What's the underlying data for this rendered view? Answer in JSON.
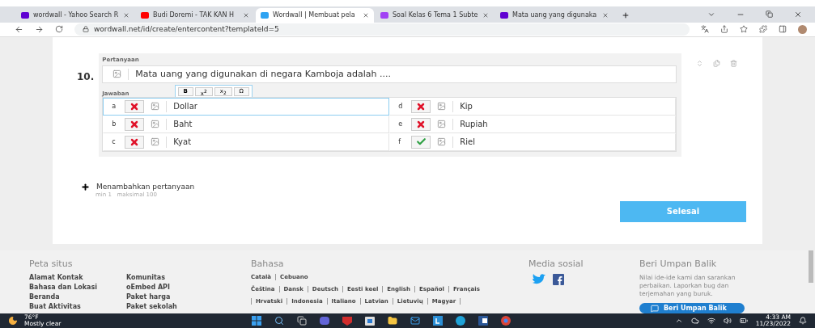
{
  "browser": {
    "tabs": [
      {
        "title": "wordwall - Yahoo Search R",
        "selected": false,
        "color": "#6001d2"
      },
      {
        "title": "Budi Doremi - TAK KAN H",
        "selected": false,
        "color": "#ff0000"
      },
      {
        "title": "Wordwall | Membuat pela",
        "selected": true,
        "color": "#2ea3f2"
      },
      {
        "title": "Soal Kelas 6 Tema 1 Subte",
        "selected": false,
        "color": "#a142f4"
      },
      {
        "title": "Mata uang yang digunaka",
        "selected": false,
        "color": "#6001d2"
      }
    ],
    "url": "wordwall.net/id/create/entercontent?templateId=5"
  },
  "question": {
    "number": "10.",
    "label": "Pertanyaan",
    "text": "Mata uang yang digunakan di negara Kamboja adalah ....",
    "answers_label": "Jawaban",
    "format_buttons": [
      "B",
      "x$^{2}$",
      "x$_{2}$",
      "Ω"
    ],
    "answers": [
      {
        "letter": "a",
        "text": "Dollar",
        "correct": false,
        "focused": true
      },
      {
        "letter": "b",
        "text": "Baht",
        "correct": false,
        "focused": false
      },
      {
        "letter": "c",
        "text": "Kyat",
        "correct": false,
        "focused": false
      },
      {
        "letter": "d",
        "text": "Kip",
        "correct": false,
        "focused": false
      },
      {
        "letter": "e",
        "text": "Rupiah",
        "correct": false,
        "focused": false
      },
      {
        "letter": "f",
        "text": "Riel",
        "correct": true,
        "focused": false
      }
    ]
  },
  "add_question": {
    "label": "Menambahkan pertanyaan",
    "hint": "min 1   maksimal 100"
  },
  "finish_button": "Selesai",
  "footer": {
    "sitemap": {
      "title": "Peta situs",
      "columns": [
        [
          "Alamat Kontak",
          "Bahasa dan Lokasi",
          "Beranda",
          "Buat Aktivitas"
        ],
        [
          "Komunitas",
          "oEmbed API",
          "Paket harga",
          "Paket sekolah"
        ]
      ]
    },
    "languages": {
      "title": "Bahasa",
      "rows": [
        {
          "items": [
            "Català",
            "Cebuano"
          ],
          "edge_bars": false
        },
        {
          "items": [
            "Čeština",
            "Dansk",
            "Deutsch",
            "Eesti keel",
            "English",
            "Español",
            "Français"
          ],
          "edge_bars": false
        },
        {
          "items": [
            "Hrvatski",
            "Indonesia",
            "Italiano",
            "Latvian",
            "Lietuvių",
            "Magyar"
          ],
          "edge_bars": true
        }
      ]
    },
    "social": {
      "title": "Media sosial"
    },
    "feedback": {
      "title": "Beri Umpan Balik",
      "text": "Nilai ide-ide kami dan sarankan perbaikan. Laporkan bug dan terjemahan yang buruk.",
      "button": "Beri Umpan Balik"
    }
  },
  "taskbar": {
    "temperature": "76°F",
    "weather": "Mostly clear",
    "time": "4:33 AM",
    "date": "11/23/2022"
  }
}
